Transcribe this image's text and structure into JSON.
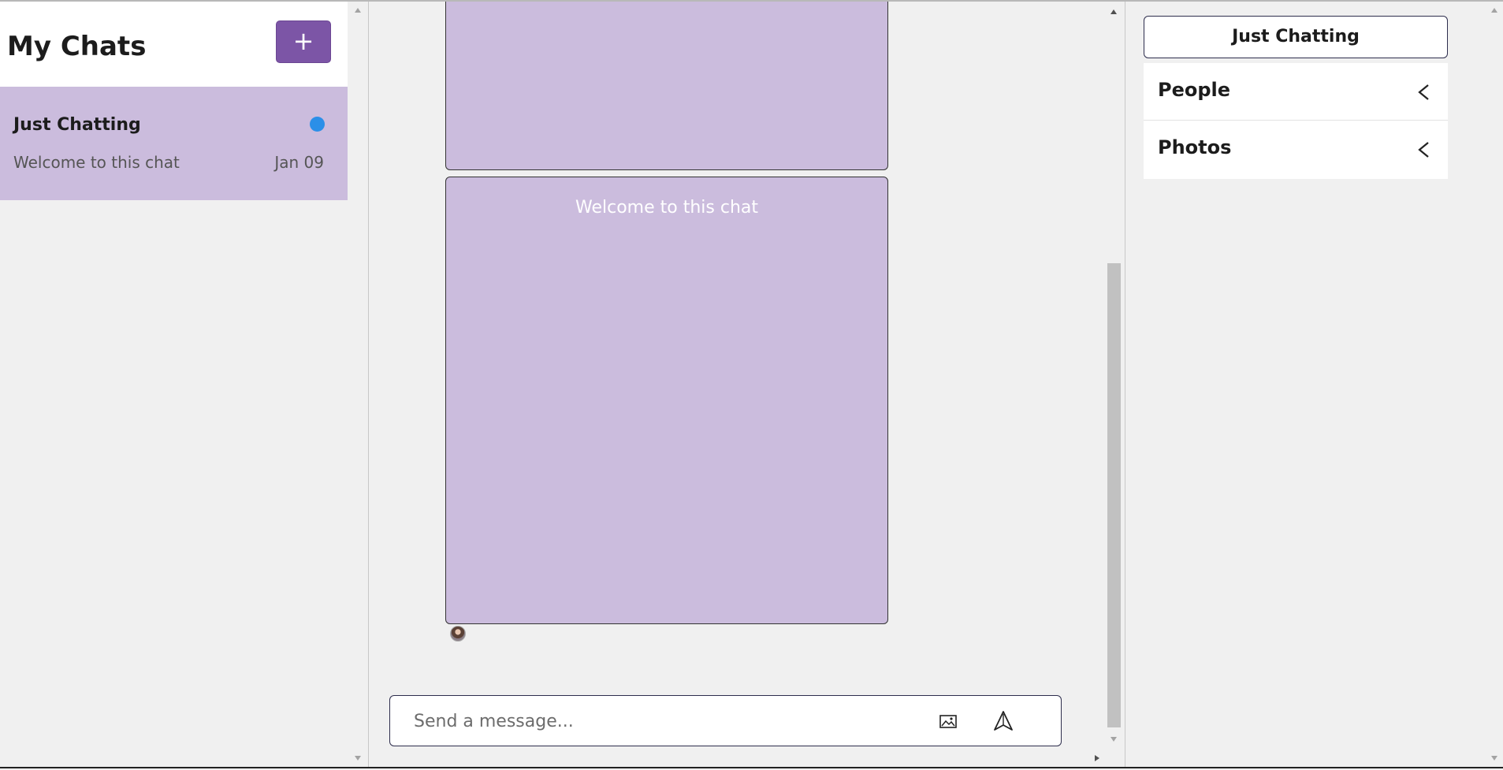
{
  "sidebar": {
    "title": "My Chats",
    "new_chat_symbol": "+",
    "chats": [
      {
        "name": "Just Chatting",
        "preview": "Welcome to this chat",
        "date": "Jan 09",
        "unread": true
      }
    ]
  },
  "conversation": {
    "messages": [
      {
        "text": ""
      },
      {
        "text": "Welcome to this chat"
      }
    ],
    "composer": {
      "placeholder": "Send a message...",
      "attach_icon": "image-icon",
      "send_icon": "send-icon"
    }
  },
  "details": {
    "room_title": "Just Chatting",
    "sections": [
      {
        "label": "People",
        "icon": "chevron-left-icon"
      },
      {
        "label": "Photos",
        "icon": "chevron-left-icon"
      }
    ]
  },
  "colors": {
    "accent": "#7c55a6",
    "bubble": "#cbbcdd",
    "unread_dot": "#2b8fe8",
    "background": "#f0f0f0"
  }
}
